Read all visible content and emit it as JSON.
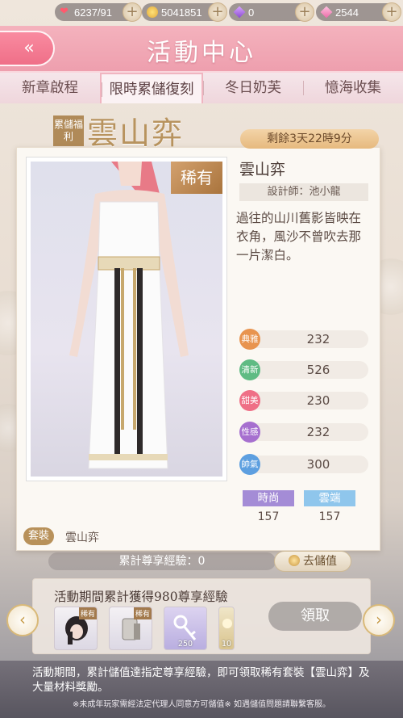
{
  "resources": {
    "stamina": "6237/91",
    "gold": "5041851",
    "purple_gem": "0",
    "pink_gem": "2544"
  },
  "header": {
    "title": "活動中心",
    "back_glyph": "«"
  },
  "tabs": [
    {
      "label": "新章啟程"
    },
    {
      "label": "限時累儲復刻"
    },
    {
      "label": "冬日奶芙"
    },
    {
      "label": "憶海收集"
    }
  ],
  "banner": {
    "welfare_label": "累儲福利",
    "suit_title": "雲山弈",
    "timer": "剩餘3天22時9分"
  },
  "card": {
    "rarity": "稀有",
    "name": "雲山弈",
    "designer": "設計師：池小龍",
    "description": "過往的山川舊影皆映在衣角，風沙不曾吹去那一片潔白。",
    "stats": [
      {
        "label": "典雅",
        "value": "232",
        "color": "#e8944f"
      },
      {
        "label": "清新",
        "value": "526",
        "color": "#5fbb83"
      },
      {
        "label": "甜美",
        "value": "230",
        "color": "#ef6f86"
      },
      {
        "label": "性感",
        "value": "232",
        "color": "#a66fcf"
      },
      {
        "label": "帥氣",
        "value": "300",
        "color": "#5d9fe0"
      }
    ],
    "tags": [
      {
        "label": "時尚",
        "value": "157",
        "color": "#a48cd6"
      },
      {
        "label": "雲端",
        "value": "157",
        "color": "#8fc6ec"
      }
    ],
    "set_tag": "套裝",
    "set_name": "雲山弈"
  },
  "exp": {
    "label": "累計尊享經驗：0",
    "store_button": "去儲值"
  },
  "reward": {
    "title": "活動期間累計獲得980尊享經驗",
    "items": [
      {
        "icon": "hair-icon",
        "rare": "稀有",
        "qty": ""
      },
      {
        "icon": "accessory-icon",
        "rare": "稀有",
        "qty": ""
      },
      {
        "icon": "key-icon",
        "rare": "",
        "qty": "250"
      },
      {
        "icon": "material-icon",
        "rare": "",
        "qty": "10"
      }
    ],
    "claim_button": "領取"
  },
  "footer": {
    "main": "活動期間，累計儲值達指定尊享經驗，即可領取稀有套裝【雲山弈】及大量材料獎勵。",
    "note": "※未成年玩家需經法定代理人同意方可儲值※ 如遇儲值問題請聯繫客服。"
  }
}
